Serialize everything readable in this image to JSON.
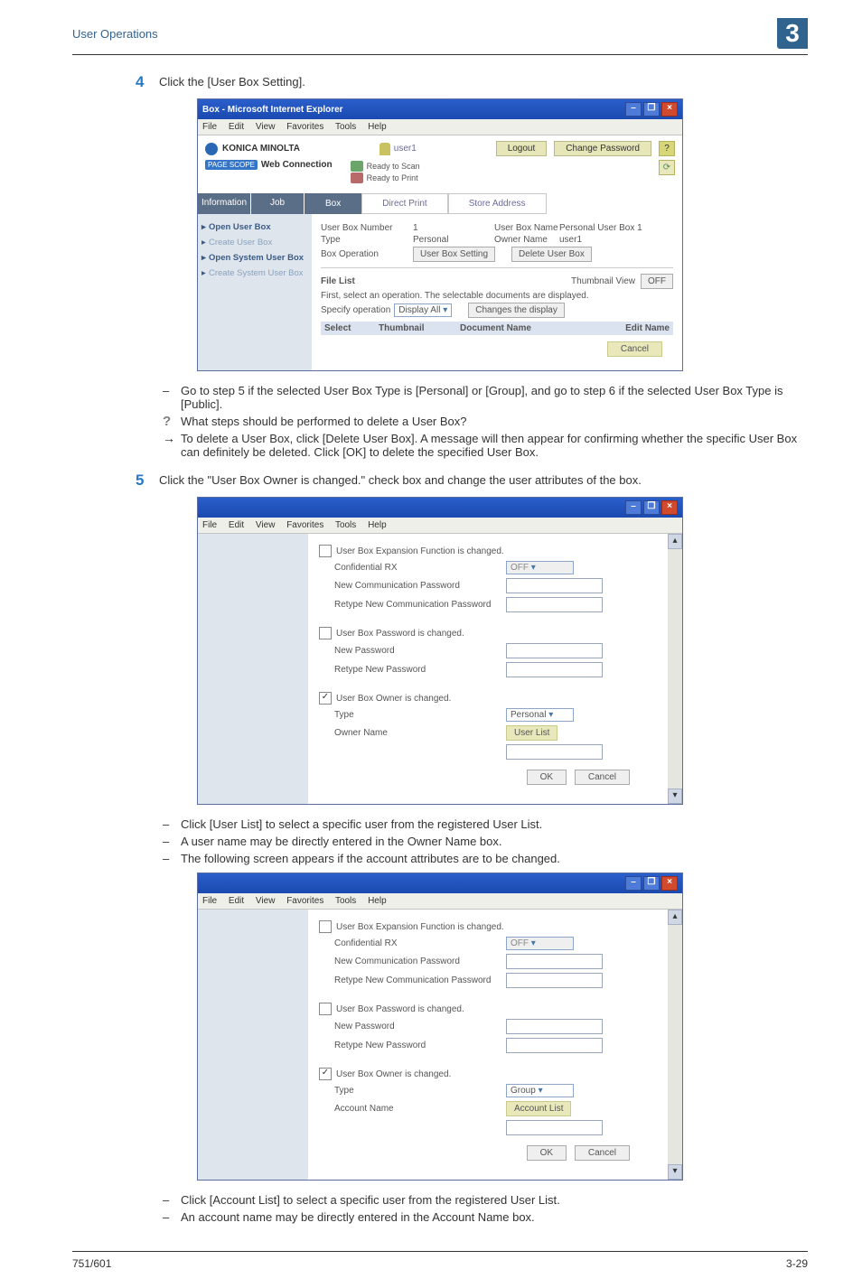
{
  "header": {
    "section_title": "User Operations",
    "chapter_num": "3"
  },
  "steps": {
    "s4_num": "4",
    "s4_text": "Click the [User Box Setting].",
    "s5_num": "5",
    "s5_text": "Click the \"User Box Owner is changed.\" check box and change the user attributes of the box."
  },
  "ie1": {
    "title": "Box - Microsoft Internet Explorer",
    "menu": {
      "file": "File",
      "edit": "Edit",
      "view": "View",
      "fav": "Favorites",
      "tools": "Tools",
      "help": "Help"
    },
    "brand": "KONICA MINOLTA",
    "pagescope": "PAGE SCOPE",
    "webc": "Web Connection",
    "user": "user1",
    "logout": "Logout",
    "changepw": "Change Password",
    "help": "?",
    "ready_scan": "Ready to Scan",
    "ready_print": "Ready to Print",
    "sidehdr1": "Information",
    "sidehdr2": "Job",
    "tab_box": "Box",
    "tab_dp": "Direct Print",
    "tab_sa": "Store Address",
    "side": {
      "a": "Open User Box",
      "b": "Create User Box",
      "c": "Open System User Box",
      "d": "Create System User Box"
    },
    "content": {
      "r1a": "User Box Number",
      "r1a_v": "1",
      "r1b": "User Box Name",
      "r1b_v": "Personal User Box 1",
      "r2a": "Type",
      "r2a_v": "Personal",
      "r2b": "Owner Name",
      "r2b_v": "user1",
      "r3a": "Box Operation",
      "btn_ubs": "User Box Setting",
      "btn_del": "Delete User Box",
      "filelist": "File List",
      "thumb": "Thumbnail View",
      "off": "OFF",
      "first": "First, select an operation. The selectable documents are displayed.",
      "spec": "Specify operation",
      "disp": "Display All",
      "chg": "Changes the display",
      "sel": "Select",
      "thcol": "Thumbnail",
      "doccol": "Document Name",
      "editcol": "Edit Name",
      "cancel": "Cancel"
    }
  },
  "notes1": {
    "a": "Go to step 5 if the selected User Box Type is [Personal] or [Group], and go to step 6 if the selected User Box Type is [Public].",
    "q": "What steps should be performed to delete a User Box?",
    "arr": "To delete a User Box, click [Delete User Box]. A message will then appear for confirming whether the specific User Box can definitely be deleted. Click [OK] to delete the specified User Box."
  },
  "ie2": {
    "l1": "User Box Expansion Function is changed.",
    "l2": "Confidential RX",
    "l2v": "OFF",
    "l3": "New Communication Password",
    "l4": "Retype New Communication Password",
    "l5": "User Box Password is changed.",
    "l6": "New Password",
    "l7": "Retype New Password",
    "l8": "User Box Owner is changed.",
    "l9": "Type",
    "l9v": "Personal",
    "l10": "Owner Name",
    "l10btn": "User List",
    "ok": "OK",
    "cancel": "Cancel"
  },
  "notes2": {
    "a": "Click [User List] to select a specific user from the registered User List.",
    "b": "A user name may be directly entered in the Owner Name box.",
    "c": "The following screen appears if the account attributes are to be changed."
  },
  "ie3": {
    "l9v": "Group",
    "l10": "Account Name",
    "l10btn": "Account List"
  },
  "notes3": {
    "a": "Click [Account List] to select a specific user from the registered User List.",
    "b": "An account name may be directly entered in the Account Name box."
  },
  "footer": {
    "left": "751/601",
    "right": "3-29"
  }
}
